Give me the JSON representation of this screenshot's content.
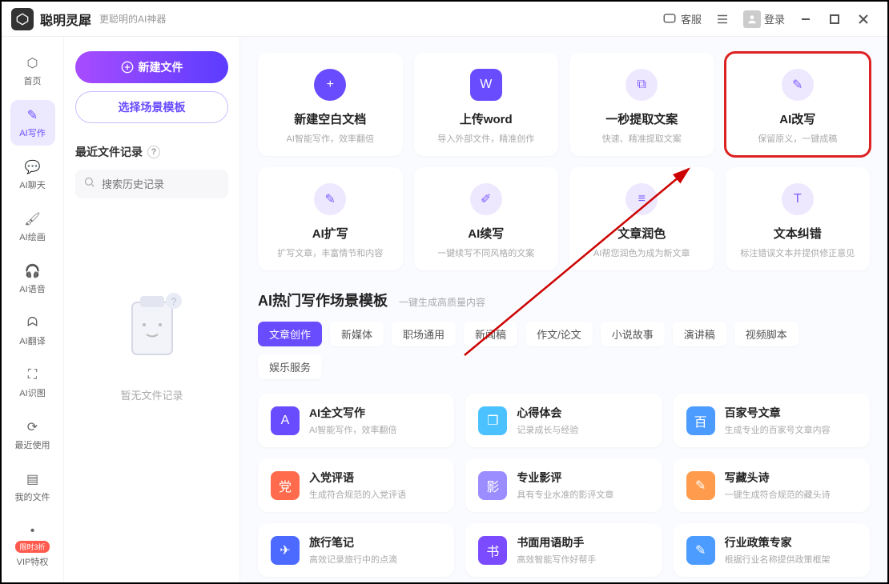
{
  "header": {
    "app_name": "聪明灵犀",
    "subtitle": "更聪明的AI神器",
    "support": "客服",
    "login": "登录"
  },
  "sidebar": [
    {
      "label": "首页"
    },
    {
      "label": "AI写作"
    },
    {
      "label": "AI聊天"
    },
    {
      "label": "AI绘画"
    },
    {
      "label": "AI语音"
    },
    {
      "label": "AI翻译"
    },
    {
      "label": "AI识图"
    },
    {
      "label": "最近使用"
    },
    {
      "label": "我的文件"
    },
    {
      "label": "VIP特权",
      "badge": "限时3折"
    }
  ],
  "files": {
    "new_file": "新建文件",
    "choose_tpl": "选择场景模板",
    "recent_title": "最近文件记录",
    "search_placeholder": "搜索历史记录",
    "empty": "暂无文件记录"
  },
  "cards_row1": [
    {
      "title": "新建空白文档",
      "desc": "AI智能写作，效率翻倍",
      "iconStyle": "round-blue",
      "glyph": "+"
    },
    {
      "title": "上传word",
      "desc": "导入外部文件，精准创作",
      "iconStyle": "blue",
      "glyph": "W"
    },
    {
      "title": "一秒提取文案",
      "desc": "快速、精准提取文案",
      "iconStyle": "light",
      "glyph": "⧉"
    },
    {
      "title": "AI改写",
      "desc": "保留原义，一键成稿",
      "iconStyle": "light",
      "glyph": "✎",
      "hl": true
    }
  ],
  "cards_row2": [
    {
      "title": "AI扩写",
      "desc": "扩写文章，丰富情节和内容",
      "iconStyle": "light",
      "glyph": "✎"
    },
    {
      "title": "AI续写",
      "desc": "一键续写不同风格的文案",
      "iconStyle": "light",
      "glyph": "✐"
    },
    {
      "title": "文章润色",
      "desc": "AI帮您润色为成为新文章",
      "iconStyle": "light",
      "glyph": "≡"
    },
    {
      "title": "文本纠错",
      "desc": "标注错误文本并提供修正意见",
      "iconStyle": "light",
      "glyph": "T"
    }
  ],
  "section": {
    "title": "AI热门写作场景模板",
    "sub": "一键生成高质量内容"
  },
  "chips": [
    "文章创作",
    "新媒体",
    "职场通用",
    "新闻稿",
    "作文/论文",
    "小说故事",
    "演讲稿",
    "视频脚本",
    "娱乐服务"
  ],
  "templates": [
    {
      "title": "AI全文写作",
      "desc": "AI智能写作，效率翻倍",
      "color": "#6a4cff",
      "glyph": "A"
    },
    {
      "title": "心得体会",
      "desc": "记录成长与经验",
      "color": "#4cc1ff",
      "glyph": "❐"
    },
    {
      "title": "百家号文章",
      "desc": "生成专业的百家号文章内容",
      "color": "#4c9bff",
      "glyph": "百"
    },
    {
      "title": "入党评语",
      "desc": "生成符合规范的入党评语",
      "color": "#ff6b4c",
      "glyph": "党"
    },
    {
      "title": "专业影评",
      "desc": "具有专业水准的影评文章",
      "color": "#9b8cff",
      "glyph": "影"
    },
    {
      "title": "写藏头诗",
      "desc": "一键生成符合规范的藏头诗",
      "color": "#ff9b4c",
      "glyph": "✎"
    },
    {
      "title": "旅行笔记",
      "desc": "高效记录旅行中的点滴",
      "color": "#4c6aff",
      "glyph": "✈"
    },
    {
      "title": "书面用语助手",
      "desc": "高效智能写作好帮手",
      "color": "#7b4cff",
      "glyph": "书"
    },
    {
      "title": "行业政策专家",
      "desc": "根据行业名称提供政策框架",
      "color": "#4c9bff",
      "glyph": "✎"
    }
  ]
}
